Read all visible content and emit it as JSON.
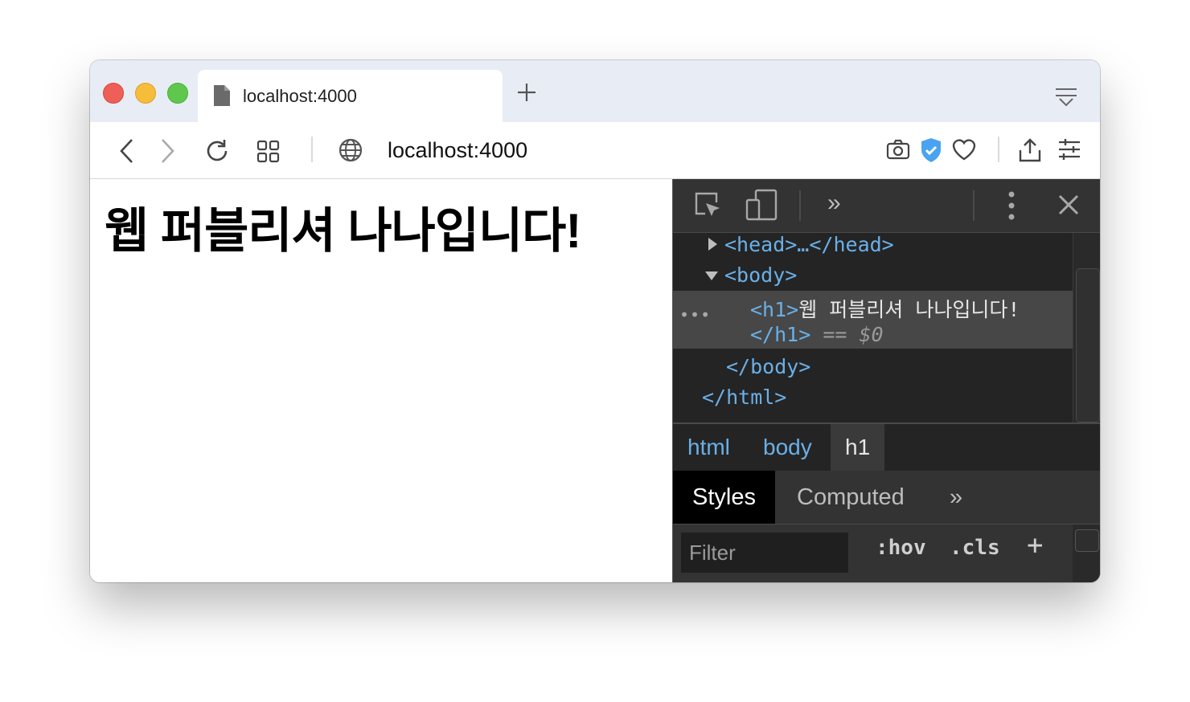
{
  "browser": {
    "tab": {
      "title": "localhost:4000",
      "icon": "document-icon"
    },
    "address_bar": {
      "url": "localhost:4000"
    },
    "colors": {
      "tabbar_bg": "#e8edf5",
      "shield_blue": "#4aa3f0",
      "close_red": "#ee5f57",
      "minimize_yellow": "#f6bd3b",
      "zoom_green": "#5fc84c"
    }
  },
  "page": {
    "heading": "웹 퍼블리셔 나나입니다!"
  },
  "devtools": {
    "dom": {
      "head_line": "<head>…</head>",
      "body_open": "<body>",
      "h1_open": "<h1>",
      "h1_text": "웹 퍼블리셔 나나입니다!",
      "h1_close": "</h1>",
      "selected_marker": " == ",
      "selected_var": "$0",
      "body_close": "</body>",
      "html_close": "</html>",
      "ellipsis": "•••"
    },
    "breadcrumbs": [
      "html",
      "body",
      "h1"
    ],
    "panel_tabs": {
      "styles": "Styles",
      "computed": "Computed",
      "more": "»"
    },
    "filter": {
      "placeholder": "Filter",
      "hov": ":hov",
      "cls": ".cls",
      "add": "+"
    },
    "toolbar": {
      "more": "»"
    },
    "colors": {
      "tag": "#6ab0e8",
      "text": "#e6e6e6",
      "panel_bg": "#242424",
      "toolbar_bg": "#333333",
      "selected_row": "#474747"
    }
  }
}
